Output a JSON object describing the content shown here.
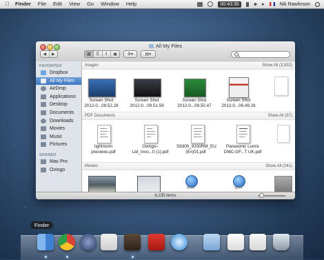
{
  "menubar": {
    "app": "Finder",
    "items": [
      "File",
      "Edit",
      "View",
      "Go",
      "Window",
      "Help"
    ],
    "clock": "00:43:35",
    "user": "Nik Rawlinson"
  },
  "window": {
    "title": "All My Files",
    "status": "6,235 items"
  },
  "sidebar": {
    "favorites_header": "FAVORITES",
    "favorites": [
      "Dropbox",
      "All My Files",
      "AirDrop",
      "Applications",
      "Desktop",
      "Documents",
      "Downloads",
      "Movies",
      "Music",
      "Pictures"
    ],
    "selected": "All My Files",
    "shared_header": "SHARED",
    "shared": [
      "Mac Pro",
      "Ovingo"
    ]
  },
  "sections": {
    "images": {
      "title": "Images",
      "show_all": "Show All (3,932)",
      "items": [
        {
          "l1": "Screen Shot",
          "l2": "2012-0...09.52.28"
        },
        {
          "l1": "Screen Shot",
          "l2": "2012-0...09.51.59"
        },
        {
          "l1": "Screen Shot",
          "l2": "2012-0...09.50.47"
        },
        {
          "l1": "Screen Shot",
          "l2": "2012-0...09.49.26"
        }
      ]
    },
    "pdf": {
      "title": "PDF Documents",
      "show_all": "Show All (57)",
      "items": [
        {
          "l1": "lightroom",
          "l2": "previews.pdf"
        },
        {
          "l1": "Ovingo–",
          "l2": "Ltd_Invo...0 (1).pdf"
        },
        {
          "l1": "S9300_9200RM_EU",
          "l2": "(En)01.pdf"
        },
        {
          "l1": "Panasonic Lumix",
          "l2": "DMC-GF...T UK.pdf"
        }
      ]
    },
    "movies": {
      "title": "Movies",
      "show_all": "Show All (241)",
      "badge": "MOV"
    }
  },
  "dock": {
    "hover_label": "Finder"
  },
  "colors": {
    "selection": "#3d75c1",
    "desktop": "#3f5f86"
  }
}
